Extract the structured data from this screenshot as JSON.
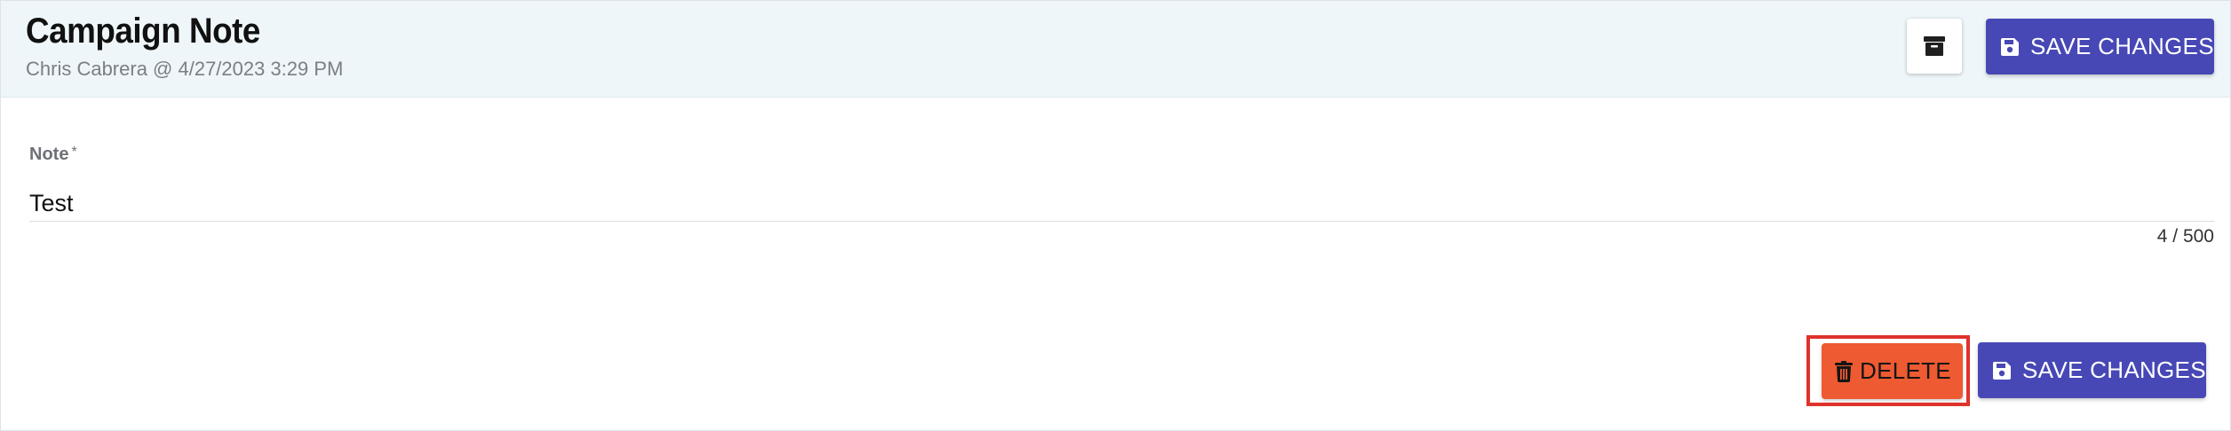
{
  "header": {
    "title": "Campaign Note",
    "subtitle": "Chris Cabrera @ 4/27/2023 3:29 PM",
    "archive_icon": "archive-box-icon",
    "save_label": "SAVE CHANGES",
    "save_icon": "floppy-disk-icon"
  },
  "form": {
    "note_label": "Note",
    "required_marker": "*",
    "note_value": "Test",
    "char_counter": "4 / 500"
  },
  "footer": {
    "delete_label": "DELETE",
    "delete_icon": "trash-icon",
    "save_label": "SAVE CHANGES",
    "save_icon": "floppy-disk-icon"
  },
  "colors": {
    "header_bg": "#eef6fa",
    "primary": "#4748b5",
    "danger": "#ee5b33",
    "highlight": "#e0322d"
  }
}
